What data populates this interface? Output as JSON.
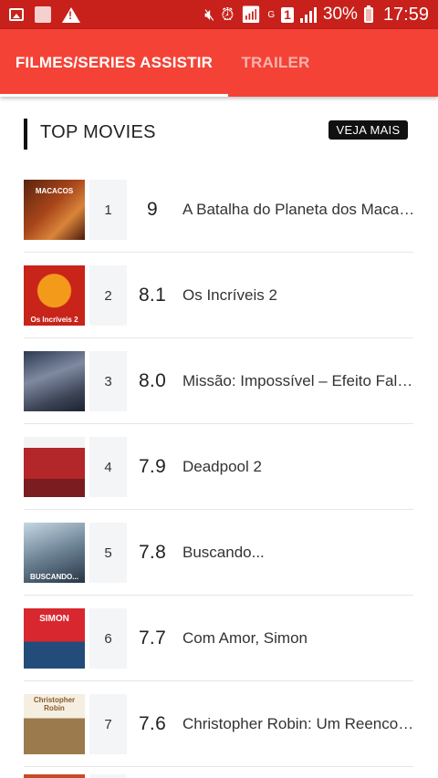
{
  "status_bar": {
    "icons_left": [
      "image-notification-icon",
      "app-notification-icon",
      "warning-icon"
    ],
    "icons_right": [
      "mute-vibrate-icon",
      "alarm-icon",
      "wifi-icon",
      "sim-1-icon",
      "signal-icon"
    ],
    "network_label": "G",
    "sim_label": "1",
    "battery_percent": "30%",
    "time": "17:59",
    "background_color": "#c8201b"
  },
  "tabs": [
    {
      "label": "FILMES/SERIES ASSISTIR",
      "selected": true
    },
    {
      "label": "TRAILER",
      "selected": false
    }
  ],
  "accent_color": "#f44336",
  "section": {
    "title": "TOP MOVIES",
    "more_label": "VEJA MAIS"
  },
  "movies": [
    {
      "rank": "1",
      "rating": "9",
      "title": "A Batalha do Planeta dos Macacos",
      "poster": "poster-planeta-dos-macacos"
    },
    {
      "rank": "2",
      "rating": "8.1",
      "title": "Os Incríveis 2",
      "poster": "poster-incriveis-2"
    },
    {
      "rank": "3",
      "rating": "8.0",
      "title": "Missão: Impossível – Efeito Fallout",
      "poster": "poster-missao-impossivel"
    },
    {
      "rank": "4",
      "rating": "7.9",
      "title": "Deadpool 2",
      "poster": "poster-deadpool-2"
    },
    {
      "rank": "5",
      "rating": "7.8",
      "title": "Buscando...",
      "poster": "poster-buscando"
    },
    {
      "rank": "6",
      "rating": "7.7",
      "title": "Com Amor, Simon",
      "poster": "poster-com-amor-simon"
    },
    {
      "rank": "7",
      "rating": "7.6",
      "title": "Christopher Robin: Um Reencontro Inesquecível",
      "poster": "poster-christopher-robin"
    }
  ],
  "poster_texts": {
    "p1": "MACACOS",
    "p2": "Os Incríveis 2",
    "p5": "BUSCANDO...",
    "p6": "SIMON",
    "p7": "Christopher Robin"
  }
}
